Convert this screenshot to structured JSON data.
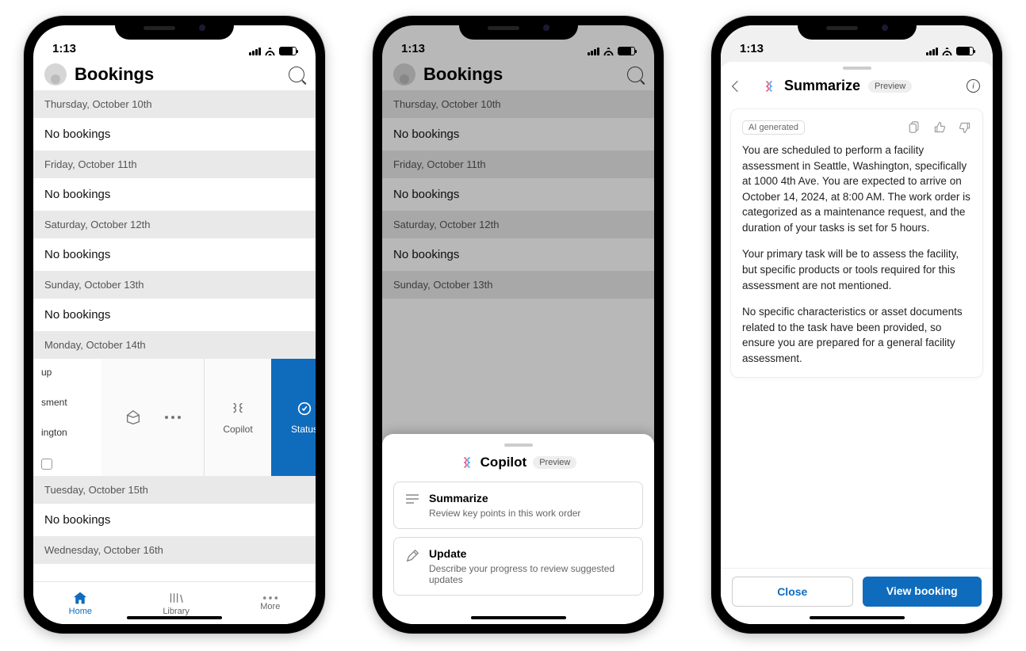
{
  "status_time": "1:13",
  "phone1": {
    "title": "Bookings",
    "days": [
      {
        "label": "Thursday, October 10th",
        "text": "No bookings"
      },
      {
        "label": "Friday, October 11th",
        "text": "No bookings"
      },
      {
        "label": "Saturday, October 12th",
        "text": "No bookings"
      },
      {
        "label": "Sunday, October 13th",
        "text": "No bookings"
      },
      {
        "label": "Monday, October 14th",
        "text": ""
      },
      {
        "label": "Tuesday, October 15th",
        "text": "No bookings"
      },
      {
        "label": "Wednesday, October 16th",
        "text": ""
      }
    ],
    "peek": {
      "line1": "up",
      "line2": "sment",
      "line3": "ington"
    },
    "actions": {
      "move": "",
      "more": "",
      "copilot": "Copilot",
      "status": "Status"
    },
    "tabs": {
      "home": "Home",
      "library": "Library",
      "more": "More"
    }
  },
  "phone2": {
    "title": "Bookings",
    "days": [
      {
        "label": "Thursday, October 10th",
        "text": "No bookings"
      },
      {
        "label": "Friday, October 11th",
        "text": "No bookings"
      },
      {
        "label": "Saturday, October 12th",
        "text": "No bookings"
      },
      {
        "label": "Sunday, October 13th",
        "text": ""
      }
    ],
    "sheet": {
      "title": "Copilot",
      "preview": "Preview",
      "cards": [
        {
          "title": "Summarize",
          "sub": "Review key points in this work order"
        },
        {
          "title": "Update",
          "sub": "Describe your progress to review suggested updates"
        }
      ]
    }
  },
  "phone3": {
    "title": "Summarize",
    "preview": "Preview",
    "ai_tag": "AI generated",
    "paras": [
      "You are scheduled to perform a facility assessment in Seattle, Washington, specifically at 1000 4th Ave. You are expected to arrive on October 14, 2024, at 8:00 AM. The work order is categorized as a maintenance request, and the duration of your tasks is set for 5 hours.",
      "Your primary task will be to assess the facility, but specific products or tools required for this assessment are not mentioned.",
      "No specific characteristics or asset documents related to the task have been provided, so ensure you are prepared for a general facility assessment."
    ],
    "close": "Close",
    "view": "View booking"
  }
}
